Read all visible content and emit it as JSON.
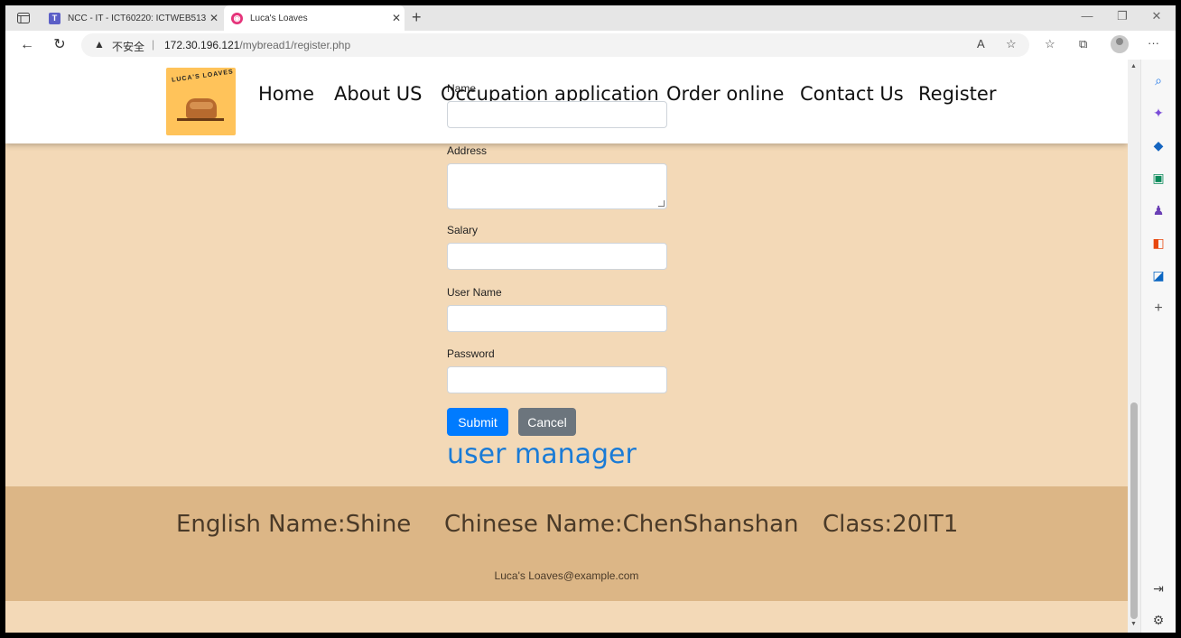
{
  "browser": {
    "tabs": [
      {
        "title": "NCC - IT - ICT60220: ICTWEB513",
        "icon": "teams-icon",
        "active": false
      },
      {
        "title": "Luca's Loaves",
        "icon": "site-icon",
        "active": true
      }
    ],
    "address": {
      "security_label": "不安全",
      "url_host": "172.30.196.121",
      "url_path": "/mybread1/register.php"
    }
  },
  "site": {
    "logo_text": "LUCA'S LOAVES",
    "nav": [
      "Home",
      "About US",
      "Occupation application",
      "Order online",
      "Contact Us",
      "Register"
    ]
  },
  "form": {
    "fields": [
      {
        "label": "Name",
        "value": ""
      },
      {
        "label": "Address",
        "value": ""
      },
      {
        "label": "Salary",
        "value": ""
      },
      {
        "label": "User Name",
        "value": ""
      },
      {
        "label": "Password",
        "value": ""
      }
    ],
    "submit_label": "Submit",
    "cancel_label": "Cancel",
    "manager_link": "user manager"
  },
  "footer": {
    "english_name": "English Name:Shine",
    "chinese_name": "Chinese Name:ChenShanshan",
    "class": "Class:20IT1",
    "email": "Luca's Loaves@example.com"
  },
  "colors": {
    "page_bg": "#f3d9b7",
    "footer_bg": "#dcb686",
    "submit": "#007bff",
    "cancel": "#6c757d",
    "link": "#1a7bd6"
  }
}
